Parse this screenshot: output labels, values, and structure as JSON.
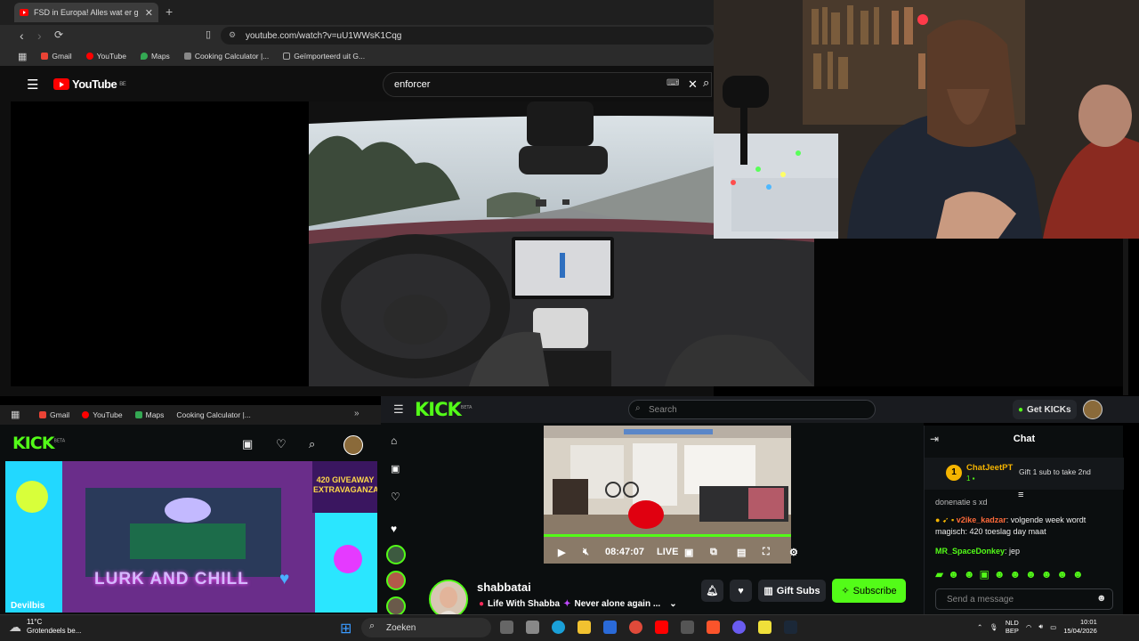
{
  "browser": {
    "tab_title": "FSD in Europa! Alles wat er g",
    "url": "youtube.com/watch?v=uU1WWsK1Cqg",
    "bookmarks": [
      {
        "label": "Gmail",
        "color": "#ea4335"
      },
      {
        "label": "YouTube",
        "color": "#ff0000"
      },
      {
        "label": "Maps",
        "color": "#34a853"
      },
      {
        "label": "Cooking Calculator |...",
        "color": "#888888"
      },
      {
        "label": "Geïmporteerd uit G...",
        "color": "#aaaaaa"
      }
    ]
  },
  "youtube": {
    "logo_text": "YouTube",
    "country": "BE",
    "search_value": "enforcer"
  },
  "kick_left": {
    "bookmarks": [
      "Gmail",
      "YouTube",
      "Maps",
      "Cooking Calculator |..."
    ],
    "logo": "KICK",
    "logo_badge": "BETA",
    "thumb_banner": "420 GIVEAWAY EXTRAVAGANZA",
    "thumb_caption": "LURK AND CHILL",
    "thumb_brand": "Devilbis"
  },
  "kick_main": {
    "logo": "KICK",
    "logo_badge": "BETA",
    "search_placeholder": "Search",
    "get_kicks": "Get KICKs",
    "player": {
      "time": "08:47:07",
      "live": "LIVE"
    },
    "streamer": {
      "name": "shabbatai",
      "title": "Life With Shabba",
      "subtitle": "Never alone again ..."
    },
    "gift_subs": "Gift Subs",
    "subscribe": "Subscribe"
  },
  "chat": {
    "title": "Chat",
    "pinned_user": "ChatJeetPT",
    "pinned_badge": "1",
    "pinned_text": "Gift 1 sub to take 2nd",
    "fragment": "donenatie s xd",
    "messages": [
      {
        "user": "v2ike_kadzar",
        "text": "volgende week wordt magisch: 420 toeslag day maat"
      },
      {
        "user": "MR_SpaceDonkey",
        "text": "jep"
      }
    ],
    "input_placeholder": "Send a message"
  },
  "taskbar": {
    "temperature": "11°C",
    "weather": "Grotendeels be...",
    "search": "Zoeken",
    "lang": "NLD",
    "region": "BEP",
    "time": "10:01",
    "date": "15/04/2026"
  },
  "colors": {
    "kick_green": "#53fc18",
    "youtube_red": "#ff0000"
  }
}
